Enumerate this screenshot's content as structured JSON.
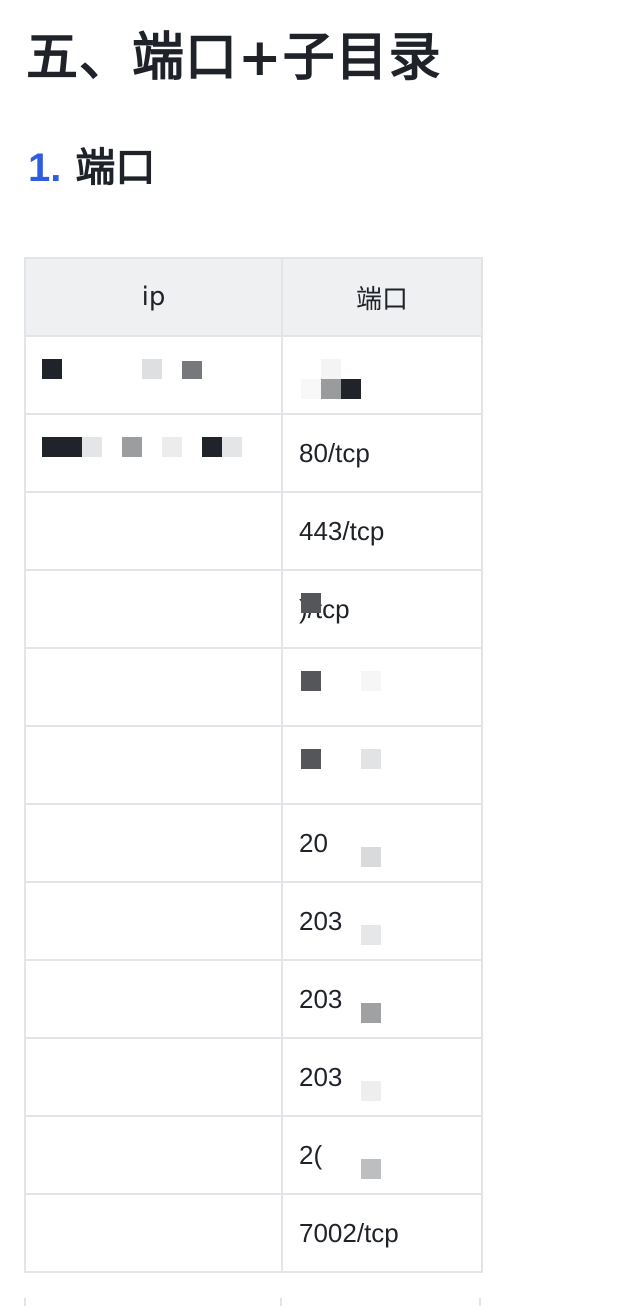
{
  "heading": "五、端口+子目录",
  "subheading": {
    "number": "1.",
    "text": "端口"
  },
  "table": {
    "headers": {
      "ip": "ip",
      "port": "端口"
    },
    "rows": [
      {
        "ip": "",
        "port": ""
      },
      {
        "ip": "",
        "port": "80/tcp"
      },
      {
        "ip": "",
        "port": "443/tcp"
      },
      {
        "ip": "",
        "port": ")/tcp"
      },
      {
        "ip": "",
        "port": ""
      },
      {
        "ip": "",
        "port": ""
      },
      {
        "ip": "",
        "port": "20"
      },
      {
        "ip": "",
        "port": "203"
      },
      {
        "ip": "",
        "port": "203"
      },
      {
        "ip": "",
        "port": "203"
      },
      {
        "ip": "",
        "port": "2("
      },
      {
        "ip": "",
        "port": "7002/tcp"
      }
    ]
  },
  "colors": {
    "heading_number": "#2f5ce0",
    "header_bg": "#eff0f1",
    "border": "#e2e4e8"
  }
}
